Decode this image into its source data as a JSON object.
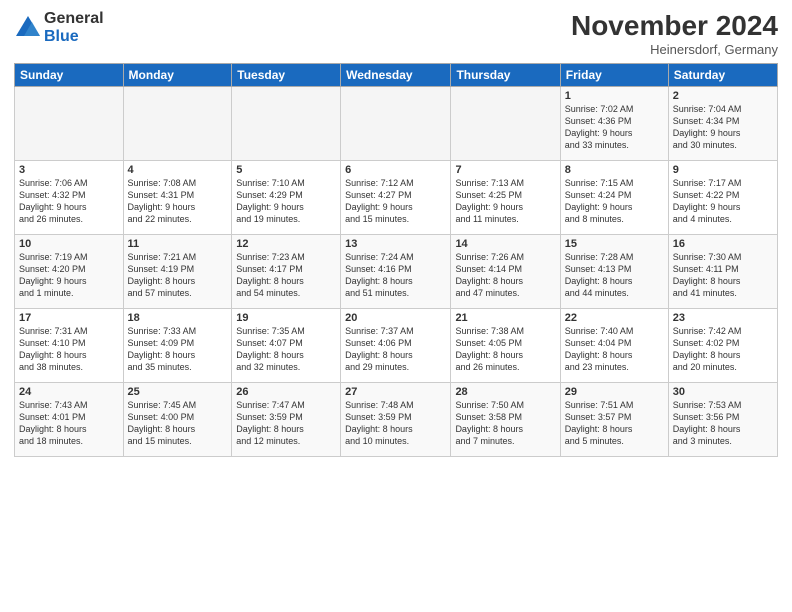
{
  "logo": {
    "general": "General",
    "blue": "Blue"
  },
  "title": "November 2024",
  "location": "Heinersdorf, Germany",
  "days_header": [
    "Sunday",
    "Monday",
    "Tuesday",
    "Wednesday",
    "Thursday",
    "Friday",
    "Saturday"
  ],
  "weeks": [
    [
      {
        "day": "",
        "info": ""
      },
      {
        "day": "",
        "info": ""
      },
      {
        "day": "",
        "info": ""
      },
      {
        "day": "",
        "info": ""
      },
      {
        "day": "",
        "info": ""
      },
      {
        "day": "1",
        "info": "Sunrise: 7:02 AM\nSunset: 4:36 PM\nDaylight: 9 hours\nand 33 minutes."
      },
      {
        "day": "2",
        "info": "Sunrise: 7:04 AM\nSunset: 4:34 PM\nDaylight: 9 hours\nand 30 minutes."
      }
    ],
    [
      {
        "day": "3",
        "info": "Sunrise: 7:06 AM\nSunset: 4:32 PM\nDaylight: 9 hours\nand 26 minutes."
      },
      {
        "day": "4",
        "info": "Sunrise: 7:08 AM\nSunset: 4:31 PM\nDaylight: 9 hours\nand 22 minutes."
      },
      {
        "day": "5",
        "info": "Sunrise: 7:10 AM\nSunset: 4:29 PM\nDaylight: 9 hours\nand 19 minutes."
      },
      {
        "day": "6",
        "info": "Sunrise: 7:12 AM\nSunset: 4:27 PM\nDaylight: 9 hours\nand 15 minutes."
      },
      {
        "day": "7",
        "info": "Sunrise: 7:13 AM\nSunset: 4:25 PM\nDaylight: 9 hours\nand 11 minutes."
      },
      {
        "day": "8",
        "info": "Sunrise: 7:15 AM\nSunset: 4:24 PM\nDaylight: 9 hours\nand 8 minutes."
      },
      {
        "day": "9",
        "info": "Sunrise: 7:17 AM\nSunset: 4:22 PM\nDaylight: 9 hours\nand 4 minutes."
      }
    ],
    [
      {
        "day": "10",
        "info": "Sunrise: 7:19 AM\nSunset: 4:20 PM\nDaylight: 9 hours\nand 1 minute."
      },
      {
        "day": "11",
        "info": "Sunrise: 7:21 AM\nSunset: 4:19 PM\nDaylight: 8 hours\nand 57 minutes."
      },
      {
        "day": "12",
        "info": "Sunrise: 7:23 AM\nSunset: 4:17 PM\nDaylight: 8 hours\nand 54 minutes."
      },
      {
        "day": "13",
        "info": "Sunrise: 7:24 AM\nSunset: 4:16 PM\nDaylight: 8 hours\nand 51 minutes."
      },
      {
        "day": "14",
        "info": "Sunrise: 7:26 AM\nSunset: 4:14 PM\nDaylight: 8 hours\nand 47 minutes."
      },
      {
        "day": "15",
        "info": "Sunrise: 7:28 AM\nSunset: 4:13 PM\nDaylight: 8 hours\nand 44 minutes."
      },
      {
        "day": "16",
        "info": "Sunrise: 7:30 AM\nSunset: 4:11 PM\nDaylight: 8 hours\nand 41 minutes."
      }
    ],
    [
      {
        "day": "17",
        "info": "Sunrise: 7:31 AM\nSunset: 4:10 PM\nDaylight: 8 hours\nand 38 minutes."
      },
      {
        "day": "18",
        "info": "Sunrise: 7:33 AM\nSunset: 4:09 PM\nDaylight: 8 hours\nand 35 minutes."
      },
      {
        "day": "19",
        "info": "Sunrise: 7:35 AM\nSunset: 4:07 PM\nDaylight: 8 hours\nand 32 minutes."
      },
      {
        "day": "20",
        "info": "Sunrise: 7:37 AM\nSunset: 4:06 PM\nDaylight: 8 hours\nand 29 minutes."
      },
      {
        "day": "21",
        "info": "Sunrise: 7:38 AM\nSunset: 4:05 PM\nDaylight: 8 hours\nand 26 minutes."
      },
      {
        "day": "22",
        "info": "Sunrise: 7:40 AM\nSunset: 4:04 PM\nDaylight: 8 hours\nand 23 minutes."
      },
      {
        "day": "23",
        "info": "Sunrise: 7:42 AM\nSunset: 4:02 PM\nDaylight: 8 hours\nand 20 minutes."
      }
    ],
    [
      {
        "day": "24",
        "info": "Sunrise: 7:43 AM\nSunset: 4:01 PM\nDaylight: 8 hours\nand 18 minutes."
      },
      {
        "day": "25",
        "info": "Sunrise: 7:45 AM\nSunset: 4:00 PM\nDaylight: 8 hours\nand 15 minutes."
      },
      {
        "day": "26",
        "info": "Sunrise: 7:47 AM\nSunset: 3:59 PM\nDaylight: 8 hours\nand 12 minutes."
      },
      {
        "day": "27",
        "info": "Sunrise: 7:48 AM\nSunset: 3:59 PM\nDaylight: 8 hours\nand 10 minutes."
      },
      {
        "day": "28",
        "info": "Sunrise: 7:50 AM\nSunset: 3:58 PM\nDaylight: 8 hours\nand 7 minutes."
      },
      {
        "day": "29",
        "info": "Sunrise: 7:51 AM\nSunset: 3:57 PM\nDaylight: 8 hours\nand 5 minutes."
      },
      {
        "day": "30",
        "info": "Sunrise: 7:53 AM\nSunset: 3:56 PM\nDaylight: 8 hours\nand 3 minutes."
      }
    ]
  ]
}
